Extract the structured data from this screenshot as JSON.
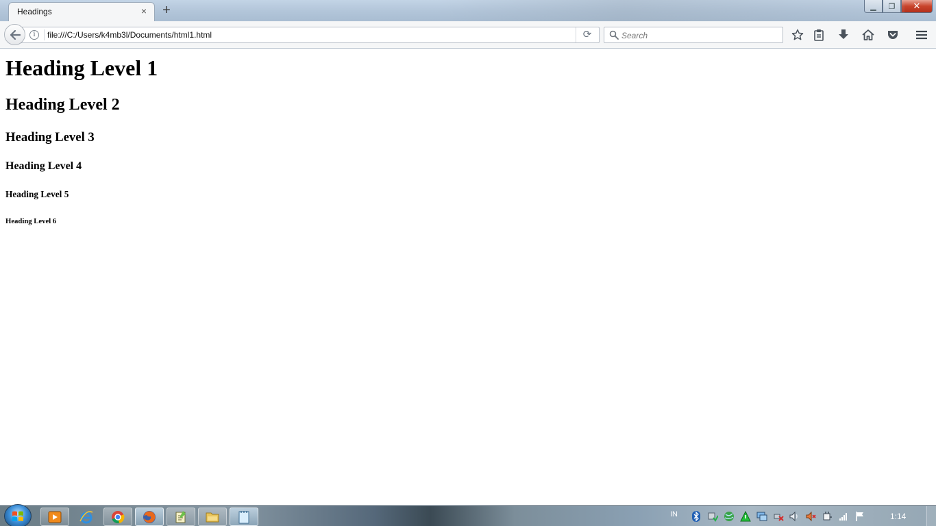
{
  "browser": {
    "tab": {
      "title": "Headings"
    },
    "address_bar": {
      "url": "file:///C:/Users/k4mb3l/Documents/html1.html"
    },
    "search_bar": {
      "placeholder": "Search"
    },
    "window_controls": {
      "minimize": "▁",
      "restore": "❐",
      "close": "✕"
    }
  },
  "page": {
    "headings": {
      "h1": "Heading Level 1",
      "h2": "Heading Level 2",
      "h3": "Heading Level 3",
      "h4": "Heading Level 4",
      "h5": "Heading Level 5",
      "h6": "Heading Level 6"
    }
  },
  "taskbar": {
    "pinned_apps": [
      "windows-media-player",
      "internet-explorer",
      "chrome",
      "firefox",
      "notepad",
      "file-explorer",
      "notepad-window"
    ],
    "tray": {
      "language": "IN",
      "clock": "1:14"
    }
  },
  "colors": {
    "titlebar": "#b3c6da",
    "toolbar": "#f5f6f7",
    "close_button": "#c8442c",
    "taskbar": "#5d7182"
  }
}
